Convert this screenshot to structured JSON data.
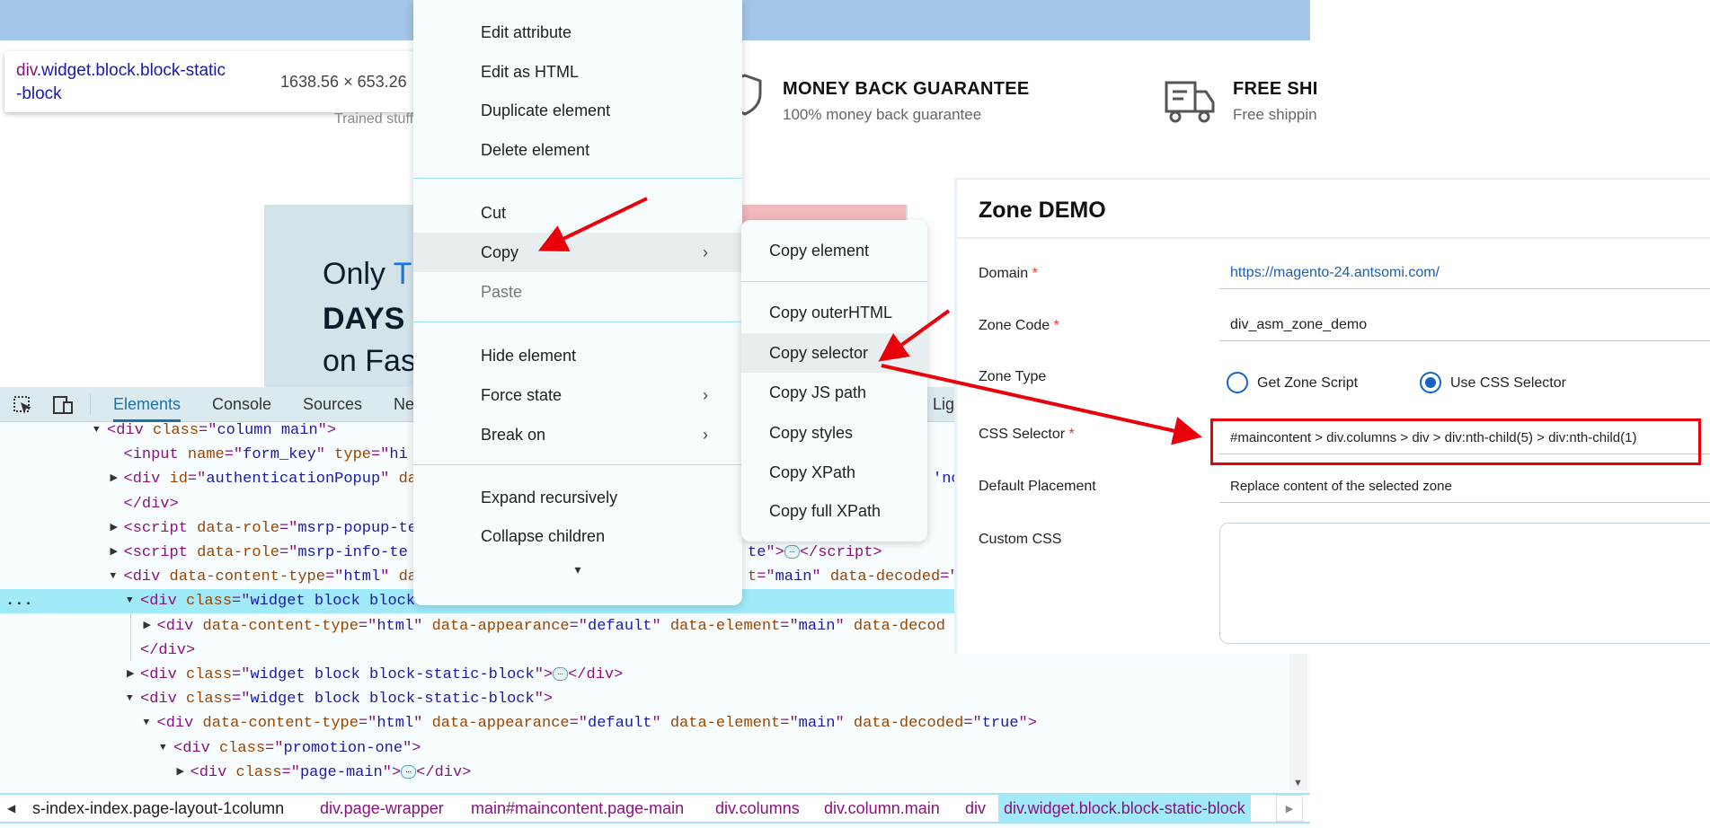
{
  "tooltip": {
    "selector_tag": "div",
    "selector_rest": ".widget.block.block-static",
    "selector_line2": "-block",
    "dimensions": "1638.56 × 653.26"
  },
  "page": {
    "trained_partial": "Trained stuffs",
    "money_back": {
      "title": "MONEY BACK GUARANTEE",
      "subtitle": "100% money back guarantee"
    },
    "free_shipping": {
      "title": "FREE SHI",
      "subtitle": "Free shippin"
    },
    "promo": {
      "line1a": "Only ",
      "line1b": "T",
      "line2": "DAYS",
      "line3": "on Fas"
    },
    "colors": {
      "top_bar": "#a3c5e8",
      "promo_bg": "#d3e3ea",
      "accent": "#1a73e8"
    }
  },
  "context_menu": {
    "items": [
      {
        "label": "Edit attribute"
      },
      {
        "label": "Edit as HTML"
      },
      {
        "label": "Duplicate element"
      },
      {
        "label": "Delete element"
      },
      {
        "label": "Cut"
      },
      {
        "label": "Copy",
        "submenu": true,
        "highlighted": true
      },
      {
        "label": "Paste",
        "disabled": true
      },
      {
        "label": "Hide element"
      },
      {
        "label": "Force state",
        "submenu": true
      },
      {
        "label": "Break on",
        "submenu": true
      },
      {
        "label": "Expand recursively"
      },
      {
        "label": "Collapse children"
      }
    ],
    "more_icon": "▾"
  },
  "copy_submenu": {
    "items": [
      {
        "label": "Copy element"
      },
      {
        "label": "Copy outerHTML"
      },
      {
        "label": "Copy selector",
        "highlighted": true
      },
      {
        "label": "Copy JS path"
      },
      {
        "label": "Copy styles"
      },
      {
        "label": "Copy XPath"
      },
      {
        "label": "Copy full XPath"
      }
    ]
  },
  "devtools": {
    "tabs": [
      {
        "label": "Elements",
        "active": true
      },
      {
        "label": "Console"
      },
      {
        "label": "Sources"
      },
      {
        "label": "Ne"
      },
      {
        "label": "Lig"
      }
    ],
    "dom_rows": [
      {
        "level": 0,
        "tri": "open",
        "segs": [
          [
            "tg",
            "<div "
          ],
          [
            "an",
            "class"
          ],
          [
            "tg",
            "=\""
          ],
          [
            "av",
            "column main"
          ],
          [
            "tg",
            "\">"
          ]
        ]
      },
      {
        "level": 1,
        "segs": [
          [
            "tg",
            "<input "
          ],
          [
            "an",
            "name"
          ],
          [
            "tg",
            "=\""
          ],
          [
            "av",
            "form_key"
          ],
          [
            "tg",
            "\" "
          ],
          [
            "an",
            "type"
          ],
          [
            "tg",
            "=\""
          ],
          [
            "av",
            "hi"
          ]
        ]
      },
      {
        "level": 1,
        "tri": "closed",
        "segs": [
          [
            "tg",
            "<div "
          ],
          [
            "an",
            "id"
          ],
          [
            "tg",
            "=\""
          ],
          [
            "av",
            "authenticationPopup"
          ],
          [
            "tg",
            "\" "
          ],
          [
            "an",
            "da"
          ]
        ],
        "right": [
          [
            "av",
            "'nc"
          ]
        ],
        "right_at": 1038
      },
      {
        "level": 1,
        "segs": [
          [
            "tg",
            "</div>"
          ]
        ]
      },
      {
        "level": 1,
        "tri": "closed",
        "segs": [
          [
            "tg",
            "<script "
          ],
          [
            "an",
            "data-role"
          ],
          [
            "tg",
            "=\""
          ],
          [
            "av",
            "msrp-popup-te"
          ]
        ]
      },
      {
        "level": 1,
        "tri": "closed",
        "segs": [
          [
            "tg",
            "<script "
          ],
          [
            "an",
            "data-role"
          ],
          [
            "tg",
            "=\""
          ],
          [
            "av",
            "msrp-info-te"
          ]
        ],
        "right": [
          [
            "av",
            "te"
          ],
          [
            "tg",
            "\">"
          ],
          [
            "ell",
            "…"
          ],
          [
            "tg",
            "</script>"
          ]
        ],
        "right_at": 832
      },
      {
        "level": 1,
        "tri": "open",
        "segs": [
          [
            "tg",
            "<div "
          ],
          [
            "an",
            "data-content-type"
          ],
          [
            "tg",
            "=\""
          ],
          [
            "av",
            "html"
          ],
          [
            "tg",
            "\" "
          ],
          [
            "an",
            "da"
          ]
        ],
        "right": [
          [
            "an",
            "t"
          ],
          [
            "tg",
            "=\""
          ],
          [
            "av",
            "main"
          ],
          [
            "tg",
            "\" "
          ],
          [
            "an",
            "data-decoded"
          ],
          [
            "tg",
            "=\""
          ]
        ],
        "right_at": 832
      },
      {
        "level": 2,
        "tri": "open",
        "hl": true,
        "dots": "...",
        "segs": [
          [
            "tg",
            "<div "
          ],
          [
            "an",
            "class"
          ],
          [
            "tg",
            "=\""
          ],
          [
            "av",
            "widget block block"
          ]
        ]
      },
      {
        "level": 3,
        "tri": "closed",
        "segs": [
          [
            "tg",
            "<div "
          ],
          [
            "an",
            "data-content-type"
          ],
          [
            "tg",
            "=\""
          ],
          [
            "av",
            "html"
          ],
          [
            "tg",
            "\" "
          ],
          [
            "an",
            "data-appearance"
          ],
          [
            "tg",
            "=\""
          ],
          [
            "av",
            "default"
          ],
          [
            "tg",
            "\" "
          ],
          [
            "an",
            "data-element"
          ],
          [
            "tg",
            "=\""
          ],
          [
            "av",
            "main"
          ],
          [
            "tg",
            "\" "
          ],
          [
            "an",
            "data-decod"
          ]
        ]
      },
      {
        "level": 2,
        "segs": [
          [
            "tg",
            "</div>"
          ]
        ]
      },
      {
        "level": 2,
        "tri": "closed",
        "segs": [
          [
            "tg",
            "<div "
          ],
          [
            "an",
            "class"
          ],
          [
            "tg",
            "=\""
          ],
          [
            "av",
            "widget block block-static-block"
          ],
          [
            "tg",
            "\">"
          ],
          [
            "ell",
            "…"
          ],
          [
            "tg",
            "</div>"
          ]
        ]
      },
      {
        "level": 2,
        "tri": "open",
        "segs": [
          [
            "tg",
            "<div "
          ],
          [
            "an",
            "class"
          ],
          [
            "tg",
            "=\""
          ],
          [
            "av",
            "widget block block-static-block"
          ],
          [
            "tg",
            "\">"
          ]
        ]
      },
      {
        "level": 3,
        "tri": "open",
        "segs": [
          [
            "tg",
            "<div "
          ],
          [
            "an",
            "data-content-type"
          ],
          [
            "tg",
            "=\""
          ],
          [
            "av",
            "html"
          ],
          [
            "tg",
            "\" "
          ],
          [
            "an",
            "data-appearance"
          ],
          [
            "tg",
            "=\""
          ],
          [
            "av",
            "default"
          ],
          [
            "tg",
            "\" "
          ],
          [
            "an",
            "data-element"
          ],
          [
            "tg",
            "=\""
          ],
          [
            "av",
            "main"
          ],
          [
            "tg",
            "\" "
          ],
          [
            "an",
            "data-decoded"
          ],
          [
            "tg",
            "=\""
          ],
          [
            "av",
            "true"
          ],
          [
            "tg",
            "\">"
          ]
        ]
      },
      {
        "level": 4,
        "tri": "open",
        "segs": [
          [
            "tg",
            "<div "
          ],
          [
            "an",
            "class"
          ],
          [
            "tg",
            "=\""
          ],
          [
            "av",
            "promotion-one"
          ],
          [
            "tg",
            "\">"
          ]
        ]
      },
      {
        "level": 5,
        "tri": "closed",
        "segs": [
          [
            "tg",
            "<div "
          ],
          [
            "an",
            "class"
          ],
          [
            "tg",
            "=\""
          ],
          [
            "av",
            "page-main"
          ],
          [
            "tg",
            "\">"
          ],
          [
            "ell",
            "…"
          ],
          [
            "tg",
            "</div>"
          ]
        ]
      }
    ],
    "breadcrumbs": [
      "s-index-index.page-layout-1column",
      "div.page-wrapper",
      "main#maincontent.page-main",
      "div.columns",
      "div.column.main",
      "div",
      "div.widget.block.block-static-block"
    ]
  },
  "zone": {
    "title": "Zone DEMO",
    "domain_label": "Domain",
    "domain_value": "https://magento-24.antsomi.com/",
    "code_label": "Zone Code",
    "code_value": "div_asm_zone_demo",
    "type_label": "Zone Type",
    "type_options": [
      "Get Zone Script",
      "Use CSS Selector"
    ],
    "type_selected": "Use CSS Selector",
    "css_label": "CSS Selector",
    "css_value": "#maincontent > div.columns > div > div:nth-child(5) > div:nth-child(1)",
    "placement_label": "Default Placement",
    "placement_value": "Replace content of the selected zone",
    "custom_css_label": "Custom CSS",
    "custom_css_value": "",
    "required_mark": "*",
    "colors": {
      "radio": "#1565c0",
      "highlight_box": "#e8000b",
      "link": "#1a5fb4"
    }
  }
}
